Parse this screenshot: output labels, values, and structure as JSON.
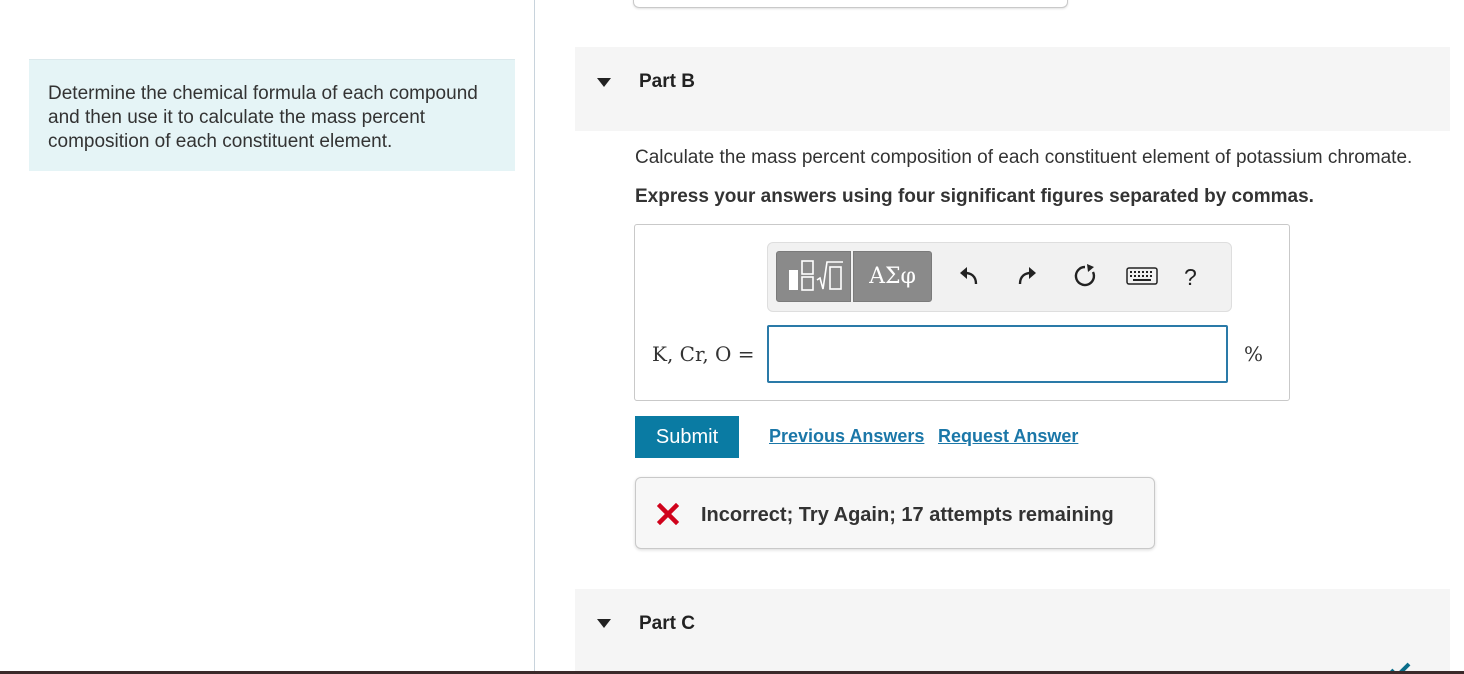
{
  "intro": {
    "text": "Determine the chemical formula of each compound and then use it to calculate the mass percent composition of each constituent element."
  },
  "part_b": {
    "title": "Part B",
    "question": "Calculate the mass percent composition of each constituent element of potassium chromate.",
    "instruction": "Express your answers using four significant figures separated by commas.",
    "toolbar": {
      "symbols_label": "ΑΣφ",
      "help_label": "?",
      "icons": [
        "templates-icon",
        "undo-icon",
        "redo-icon",
        "reset-icon",
        "keyboard-icon",
        "help-icon"
      ]
    },
    "equation_label": "K, Cr, O =",
    "answer_value": "",
    "answer_placeholder": "",
    "unit": "%",
    "submit_label": "Submit",
    "previous_answers_label": "Previous Answers",
    "request_answer_label": "Request Answer",
    "feedback": {
      "status": "incorrect",
      "text": "Incorrect; Try Again; 17 attempts remaining",
      "icon_color": "#d0021b"
    }
  },
  "part_c": {
    "title": "Part C"
  },
  "colors": {
    "accent": "#0a7ba3",
    "link": "#1b77a8",
    "intro_bg": "#e5f4f6",
    "input_border": "#2a7aa8"
  }
}
